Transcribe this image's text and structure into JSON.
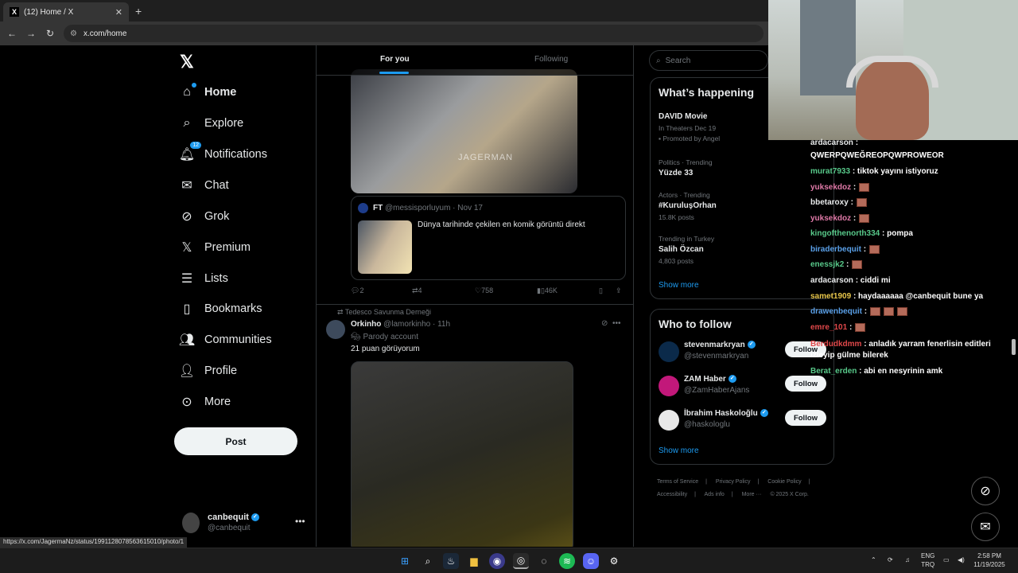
{
  "browser": {
    "tab_title": "(12) Home / X",
    "url": "x.com/home"
  },
  "nav": {
    "items": [
      {
        "label": "Home",
        "icon": "home-icon"
      },
      {
        "label": "Explore",
        "icon": "search-icon"
      },
      {
        "label": "Notifications",
        "icon": "bell-icon",
        "badge": "12"
      },
      {
        "label": "Chat",
        "icon": "mail-icon"
      },
      {
        "label": "Grok",
        "icon": "grok-icon"
      },
      {
        "label": "Premium",
        "icon": "x-logo-icon"
      },
      {
        "label": "Lists",
        "icon": "list-icon"
      },
      {
        "label": "Bookmarks",
        "icon": "bookmark-icon"
      },
      {
        "label": "Communities",
        "icon": "people-icon"
      },
      {
        "label": "Profile",
        "icon": "person-icon"
      },
      {
        "label": "More",
        "icon": "more-circle-icon"
      }
    ],
    "post_label": "Post",
    "account": {
      "name": "canbequit",
      "handle": "@canbequit"
    }
  },
  "feed": {
    "tabs": [
      "For you",
      "Following"
    ],
    "tweet1": {
      "media_watermark": "JAGERMAN",
      "quote": {
        "name": "FT",
        "handle": "@messisporluyum · Nov 17",
        "text": "Dünya tarihinde çekilen en komik görüntü direkt"
      },
      "replies": "2",
      "reposts": "4",
      "likes": "758",
      "views": "46K"
    },
    "tweet2": {
      "reposted_by": "Tedesco Savunma Derneği",
      "name": "Orkinho",
      "handle": "@lamorkinho · 11h",
      "parody": "Parody account",
      "text": "21 puan görüyorum"
    }
  },
  "right": {
    "search_placeholder": "Search",
    "happening_title": "What’s happening",
    "trends": [
      {
        "meta": "",
        "title": "DAVID Movie",
        "sub": "In Theaters Dec 19",
        "extra": "Promoted by Angel"
      },
      {
        "meta": "Politics · Trending",
        "title": "Yüzde 33",
        "sub": "",
        "extra": ""
      },
      {
        "meta": "Actors · Trending",
        "title": "#KuruluşOrhan",
        "sub": "15.8K posts",
        "extra": ""
      },
      {
        "meta": "Trending in Turkey",
        "title": "Salih Özcan",
        "sub": "4,803 posts",
        "extra": ""
      }
    ],
    "show_more": "Show more",
    "who_title": "Who to follow",
    "follow_label": "Follow",
    "who": [
      {
        "name": "stevenmarkryan",
        "handle": "@stevenmarkryan",
        "avatar_color": "#0b2a4a"
      },
      {
        "name": "ZAM Haber",
        "handle": "@ZamHaberAjans",
        "avatar_color": "#c2187a"
      },
      {
        "name": "İbrahim Haskoloğlu",
        "handle": "@haskologlu",
        "avatar_color": "#ffffff"
      }
    ],
    "footer": [
      "Terms of Service",
      "|",
      "Privacy Policy",
      "|",
      "Cookie Policy",
      "|",
      "Accessibility",
      "|",
      "Ads info",
      "|",
      "More ···",
      "© 2025 X Corp."
    ]
  },
  "chat": [
    {
      "user": "ardacarson",
      "color": "#e7e9ea",
      "text": ":"
    },
    {
      "user": "",
      "color": "#ffffff",
      "text": "QWERPQWEĞREOPQWPROWEOR"
    },
    {
      "user": "murat7933",
      "color": "#58c98a",
      "text": ": tiktok yayını istiyoruz"
    },
    {
      "user": "yuksekdoz",
      "color": "#e07aa8",
      "text": ":",
      "emotes": 1
    },
    {
      "user": "bbetaroxy",
      "color": "#e7e9ea",
      "text": ":",
      "emotes": 1
    },
    {
      "user": "yuksekdoz",
      "color": "#e07aa8",
      "text": ":",
      "emotes": 1
    },
    {
      "user": "kingofthenorth334",
      "color": "#58c98a",
      "text": ": pompa"
    },
    {
      "user": "biraderbequit",
      "color": "#5aa0e8",
      "text": ":",
      "emotes": 1
    },
    {
      "user": "enessjk2",
      "color": "#58c98a",
      "text": ":",
      "emotes": 1
    },
    {
      "user": "ardacarson",
      "color": "#e7e9ea",
      "text": ": ciddi mi"
    },
    {
      "user": "samet1909",
      "color": "#e8c64a",
      "text": ": haydaaaaaa @canbequit bune ya"
    },
    {
      "user": "drawenbequit",
      "color": "#5aa0e8",
      "text": ":",
      "emotes": 3
    },
    {
      "user": "emre_101",
      "color": "#e0484a",
      "text": ":",
      "emotes": 1
    },
    {
      "user": "Berdudkdmm",
      "color": "#e0484a",
      "text": ": anladık yarram fenerlisin editleri izleyip gülme bilerek"
    },
    {
      "user": "Berat_erden",
      "color": "#58c98a",
      "text": ": abi en nesyrinin amk"
    }
  ],
  "status_url": "https://x.com/JagermaNz/status/1991128078563615010/photo/1",
  "taskbar": {
    "lang_top": "ENG",
    "lang_bottom": "TRQ",
    "time": "2:58 PM",
    "date": "11/19/2025"
  }
}
